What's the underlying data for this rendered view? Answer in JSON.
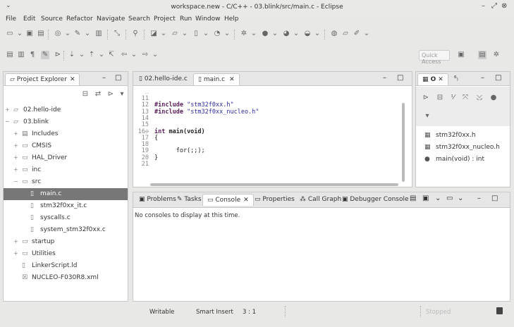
{
  "window": {
    "title": "workspace.new - C/C++ - 03.blink/src/main.c - Eclipse",
    "menu_arrow": "⌄",
    "controls": {
      "minimize": "–",
      "maximize": "⤢",
      "close": "⊗"
    }
  },
  "menu": [
    "File",
    "Edit",
    "Source",
    "Refactor",
    "Navigate",
    "Search",
    "Project",
    "Run",
    "Window",
    "Help"
  ],
  "quick_access": {
    "placeholder": "Quick Access"
  },
  "project_explorer": {
    "tab_label": "Project Explorer",
    "close_glyph": "✕",
    "items": [
      {
        "label": "02.hello-ide",
        "level": 0,
        "expander": "+",
        "icon": "▱"
      },
      {
        "label": "03.blink",
        "level": 0,
        "expander": "−",
        "icon": "▱"
      },
      {
        "label": "Includes",
        "level": 1,
        "expander": "+",
        "icon": "▤"
      },
      {
        "label": "CMSIS",
        "level": 1,
        "expander": "+",
        "icon": "▭"
      },
      {
        "label": "HAL_Driver",
        "level": 1,
        "expander": "+",
        "icon": "▭"
      },
      {
        "label": "inc",
        "level": 1,
        "expander": "+",
        "icon": "▭"
      },
      {
        "label": "src",
        "level": 1,
        "expander": "−",
        "icon": "▭"
      },
      {
        "label": "main.c",
        "level": 2,
        "expander": "",
        "icon": "▯",
        "selected": true
      },
      {
        "label": "stm32f0xx_it.c",
        "level": 2,
        "expander": "",
        "icon": "▯"
      },
      {
        "label": "syscalls.c",
        "level": 2,
        "expander": "",
        "icon": "▯"
      },
      {
        "label": "system_stm32f0xx.c",
        "level": 2,
        "expander": "",
        "icon": "▯"
      },
      {
        "label": "startup",
        "level": 1,
        "expander": "+",
        "icon": "▭"
      },
      {
        "label": "Utilities",
        "level": 1,
        "expander": "+",
        "icon": "▭"
      },
      {
        "label": "LinkerScript.ld",
        "level": 1,
        "expander": "",
        "icon": "▯"
      },
      {
        "label": "NUCLEO-F030R8.xml",
        "level": 1,
        "expander": "",
        "icon": "☒"
      }
    ]
  },
  "editor": {
    "tabs": [
      {
        "label": "02.hello-ide.c",
        "active": false
      },
      {
        "label": "main.c",
        "active": true
      }
    ],
    "lines": [
      {
        "n": "11",
        "code": ""
      },
      {
        "n": "12",
        "pre": "#include",
        "str": " \"stm32f0xx.h\""
      },
      {
        "n": "13",
        "pre": "#include",
        "str": " \"stm32f0xx_nucleo.h\""
      },
      {
        "n": "14",
        "code": ""
      },
      {
        "n": "15",
        "code": ""
      },
      {
        "n": "16⊖",
        "pre": "int",
        "rest": " main(void)"
      },
      {
        "n": "17",
        "code": "{"
      },
      {
        "n": "18",
        "code": ""
      },
      {
        "n": "19",
        "code": "      for(;;);"
      },
      {
        "n": "20",
        "code": "}"
      },
      {
        "n": "21",
        "code": ""
      }
    ]
  },
  "outline": {
    "tab_label": "O",
    "items": [
      {
        "label": "stm32f0xx.h",
        "icon": "▦"
      },
      {
        "label": "stm32f0xx_nucleo.h",
        "icon": "▦"
      },
      {
        "label": "main(void) : int",
        "icon": "●"
      }
    ]
  },
  "console": {
    "tabs": [
      "Problems",
      "Tasks",
      "Console",
      "Properties",
      "Call Graph",
      "Debugger Console"
    ],
    "active_tab": "Console",
    "message": "No consoles to display at this time."
  },
  "status": {
    "writable": "Writable",
    "insert_mode": "Smart Insert",
    "position": "3 : 1",
    "stopped": "Stopped"
  }
}
